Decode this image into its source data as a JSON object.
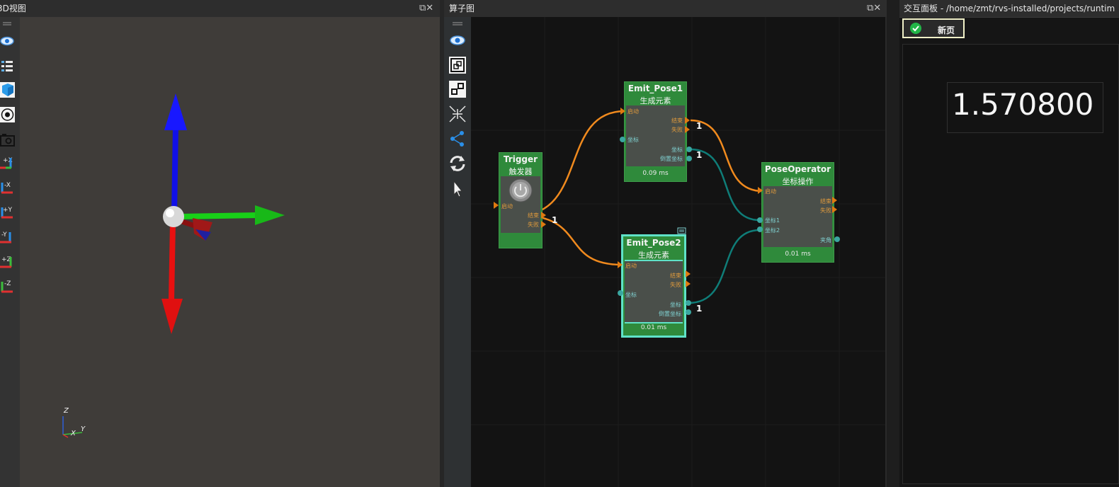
{
  "panels": {
    "view3d": {
      "title": "3D视图",
      "controls": "⧉✕"
    },
    "graph": {
      "title": "算子图",
      "controls": "⧉✕"
    },
    "interact": {
      "title": "交互面板 - /home/zmt/rvs-installed/projects/runtim"
    }
  },
  "view3d_toolbar": [
    {
      "name": "eye-icon"
    },
    {
      "name": "list-tree-icon"
    },
    {
      "name": "cube-icon"
    },
    {
      "name": "target-icon"
    },
    {
      "name": "camera-icon"
    },
    {
      "name": "view-plus-x-icon",
      "label": "+X"
    },
    {
      "name": "view-minus-x-icon",
      "label": "-X"
    },
    {
      "name": "view-plus-y-icon",
      "label": "+Y"
    },
    {
      "name": "view-minus-y-icon",
      "label": "-Y"
    },
    {
      "name": "view-plus-z-icon",
      "label": "+Z"
    },
    {
      "name": "view-minus-z-icon",
      "label": "-Z"
    }
  ],
  "axes_mini": {
    "z": "Z",
    "x": "X",
    "y": "Y"
  },
  "graph_toolbar": [
    {
      "name": "eye-icon"
    },
    {
      "name": "fit-view-icon"
    },
    {
      "name": "zoom-node-icon"
    },
    {
      "name": "collapse-icon"
    },
    {
      "name": "share-graph-icon"
    },
    {
      "name": "refresh-icon"
    },
    {
      "name": "cursor-icon"
    }
  ],
  "nodes": {
    "trigger": {
      "title": "Trigger",
      "subtitle": "触发器",
      "in_start": "启动",
      "out_end": "结束",
      "out_fail": "失败"
    },
    "emit1": {
      "title": "Emit_Pose1",
      "subtitle": "生成元素",
      "in_start": "启动",
      "in_pose": "坐标",
      "out_end": "结束",
      "out_fail": "失败",
      "out_pose": "坐标",
      "out_pose_inv": "倒置坐标",
      "time": "0.09 ms"
    },
    "emit2": {
      "title": "Emit_Pose2",
      "subtitle": "生成元素",
      "in_start": "启动",
      "in_pose": "坐标",
      "out_end": "结束",
      "out_fail": "失败",
      "out_pose": "坐标",
      "out_pose_inv": "倒置坐标",
      "time": "0.01 ms"
    },
    "poseop": {
      "title": "PoseOperator",
      "subtitle": "坐标操作",
      "in_start": "启动",
      "in_pose1": "坐标1",
      "in_pose2": "坐标2",
      "out_end": "结束",
      "out_fail": "失败",
      "out_angle": "夹角",
      "time": "0.01 ms"
    }
  },
  "link_marks": {
    "trigger_end": "1",
    "emit1_end": "1",
    "emit1_pose": "1",
    "emit2_pose": "1"
  },
  "interact": {
    "page_button": "新页",
    "value": "1.570800"
  },
  "colors": {
    "node_green": "#2f8a3b",
    "link_orange": "#f08a1e",
    "link_teal": "#0f7d78",
    "selected": "#5fe2c8"
  }
}
